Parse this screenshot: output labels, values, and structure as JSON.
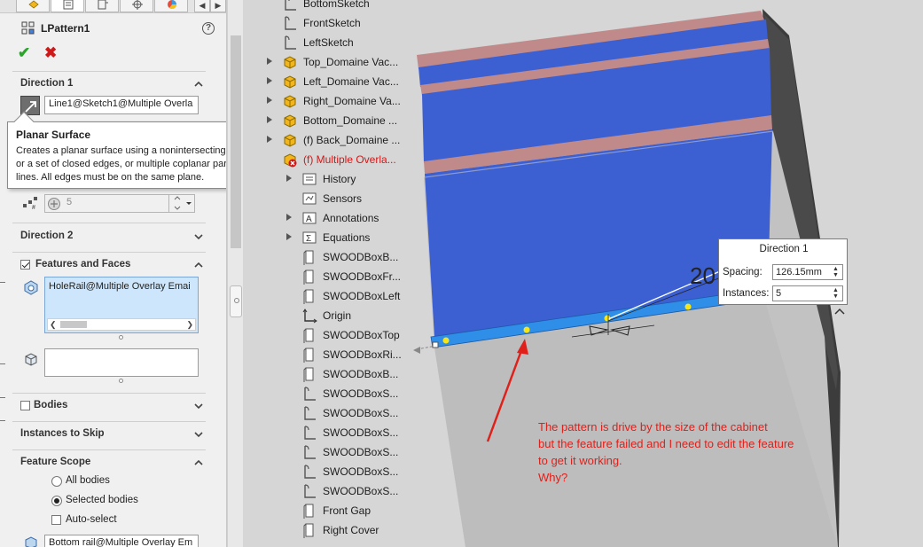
{
  "property_manager": {
    "title": "LPattern1",
    "direction1": {
      "header": "Direction 1",
      "edge_field": "Line1@Sketch1@Multiple Overla",
      "instances": "5"
    },
    "tooltip": {
      "title": "Planar Surface",
      "body": [
        "Creates a planar surface using a nonintersecting sketch",
        "or a set of closed edges, or multiple coplanar parting",
        "lines. All edges must be on the same plane."
      ]
    },
    "direction2": {
      "header": "Direction 2"
    },
    "features_and_faces": {
      "header": "Features and Faces",
      "checked": true,
      "selection": "HoleRail@Multiple Overlay Emai"
    },
    "bodies": {
      "header": "Bodies",
      "checked": false
    },
    "instances_to_skip": {
      "header": "Instances to Skip"
    },
    "feature_scope": {
      "header": "Feature Scope",
      "options": [
        "All bodies",
        "Selected bodies"
      ],
      "selected": "Selected bodies",
      "auto_select": "Auto-select",
      "auto_select_checked": false,
      "body_field": "Bottom rail@Multiple Overlay Em"
    }
  },
  "feature_tree": [
    {
      "label": "BottomSketch",
      "icon": "sketch-icon",
      "expandable": false
    },
    {
      "label": "FrontSketch",
      "icon": "sketch-icon",
      "expandable": false
    },
    {
      "label": "LeftSketch",
      "icon": "sketch-icon",
      "expandable": false
    },
    {
      "label": "Top_Domaine Vac...",
      "icon": "part-icon",
      "expandable": true
    },
    {
      "label": "Left_Domaine Vac...",
      "icon": "part-icon",
      "expandable": true
    },
    {
      "label": "Right_Domaine Va...",
      "icon": "part-icon",
      "expandable": true
    },
    {
      "label": "Bottom_Domaine ...",
      "icon": "part-icon",
      "expandable": true
    },
    {
      "label": "(f) Back_Domaine ...",
      "icon": "part-icon",
      "expandable": true
    },
    {
      "label": "(f) Multiple Overla...",
      "icon": "assembly-error-icon",
      "expandable": false,
      "error": true
    },
    {
      "label": "History",
      "icon": "history-icon",
      "expandable": true
    },
    {
      "label": "Sensors",
      "icon": "sensors-icon",
      "expandable": false
    },
    {
      "label": "Annotations",
      "icon": "annotations-icon",
      "expandable": true
    },
    {
      "label": "Equations",
      "icon": "equations-icon",
      "expandable": true
    },
    {
      "label": "SWOODBoxB...",
      "icon": "plane-icon",
      "expandable": false
    },
    {
      "label": "SWOODBoxFr...",
      "icon": "plane-icon",
      "expandable": false
    },
    {
      "label": "SWOODBoxLeft",
      "icon": "plane-icon",
      "expandable": false
    },
    {
      "label": "Origin",
      "icon": "origin-icon",
      "expandable": false
    },
    {
      "label": "SWOODBoxTop",
      "icon": "plane-icon",
      "expandable": false
    },
    {
      "label": "SWOODBoxRi...",
      "icon": "plane-icon",
      "expandable": false
    },
    {
      "label": "SWOODBoxB...",
      "icon": "plane-icon",
      "expandable": false
    },
    {
      "label": "SWOODBoxS...",
      "icon": "sketch-icon",
      "expandable": false
    },
    {
      "label": "SWOODBoxS...",
      "icon": "sketch-icon",
      "expandable": false
    },
    {
      "label": "SWOODBoxS...",
      "icon": "sketch-icon",
      "expandable": false
    },
    {
      "label": "SWOODBoxS...",
      "icon": "sketch-icon",
      "expandable": false
    },
    {
      "label": "SWOODBoxS...",
      "icon": "sketch-icon",
      "expandable": false
    },
    {
      "label": "SWOODBoxS...",
      "icon": "sketch-icon",
      "expandable": false
    },
    {
      "label": "Front Gap",
      "icon": "plane-icon",
      "expandable": false
    },
    {
      "label": "Right Cover",
      "icon": "plane-icon",
      "expandable": false
    }
  ],
  "viewport": {
    "callout": {
      "title": "Direction 1",
      "spacing_label": "Spacing:",
      "spacing_value": "126.15mm",
      "instances_label": "Instances:",
      "instances_value": "5"
    },
    "dimension_text": "20",
    "annotation_lines": [
      "The pattern is drive by the size of the cabinet",
      "but the feature failed and I need to edit the feature",
      "to get it working.",
      "Why?"
    ],
    "colors": {
      "panel_blue": "#3c5fd1",
      "rail_blue": "#2f8fe8",
      "cabinet_gray": "#c0c0c0",
      "side_dark": "#3c3c3c",
      "annotation_red": "#e0201a",
      "seed_points": "#f5e51a"
    }
  }
}
